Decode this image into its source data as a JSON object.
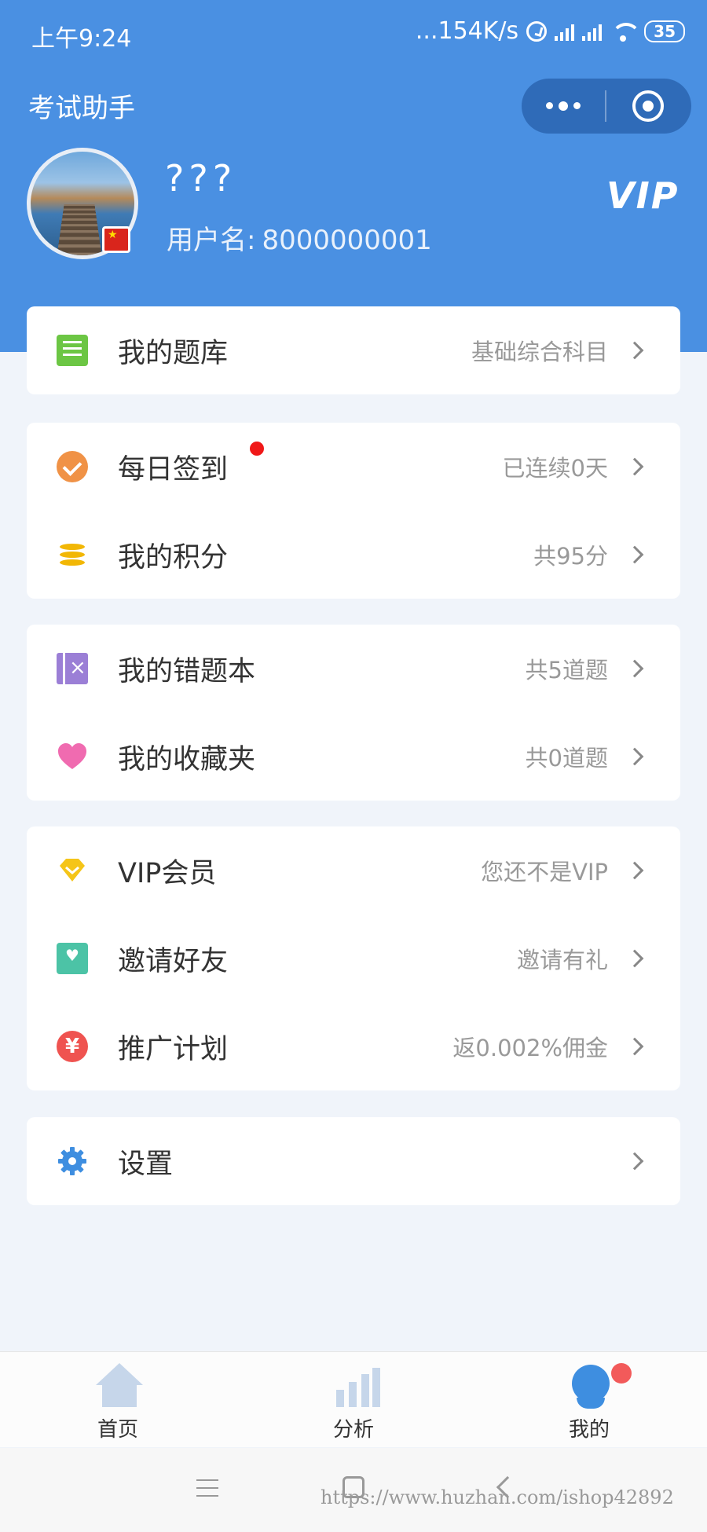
{
  "status_bar": {
    "time": "上午9:24",
    "network_speed": "...154K/s",
    "battery": "35"
  },
  "header": {
    "app_title": "考试助手",
    "user_name": "???",
    "user_id_label": "用户名:",
    "user_id": "8000000001",
    "vip_badge": "VIP"
  },
  "menu": {
    "question_bank": {
      "label": "我的题库",
      "value": "基础综合科目"
    },
    "daily_checkin": {
      "label": "每日签到",
      "value": "已连续0天"
    },
    "my_points": {
      "label": "我的积分",
      "value": "共95分"
    },
    "wrong_book": {
      "label": "我的错题本",
      "value": "共5道题"
    },
    "favorites": {
      "label": "我的收藏夹",
      "value": "共0道题"
    },
    "vip_member": {
      "label": "VIP会员",
      "value": "您还不是VIP"
    },
    "invite_friends": {
      "label": "邀请好友",
      "value": "邀请有礼"
    },
    "promotion": {
      "label": "推广计划",
      "value": "返0.002%佣金"
    },
    "settings": {
      "label": "设置",
      "value": ""
    }
  },
  "tab_bar": {
    "tabs": [
      {
        "label": "首页",
        "icon": "home-icon"
      },
      {
        "label": "分析",
        "icon": "bar-chart-icon"
      },
      {
        "label": "我的",
        "icon": "user-icon"
      }
    ]
  },
  "watermark": "https://www.huzhan.com/ishop42892",
  "colors": {
    "header_bg": "#4a90e2",
    "page_bg": "#f0f4fa",
    "accent": "#3e8ee0",
    "badge_red": "#f01818"
  }
}
